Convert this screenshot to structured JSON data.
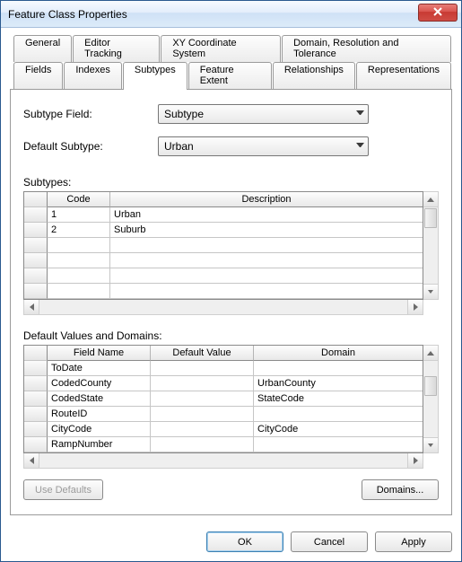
{
  "window": {
    "title": "Feature Class Properties"
  },
  "tabs_row1": [
    {
      "label": "General"
    },
    {
      "label": "Editor Tracking"
    },
    {
      "label": "XY Coordinate System"
    },
    {
      "label": "Domain, Resolution and Tolerance"
    }
  ],
  "tabs_row2": [
    {
      "label": "Fields"
    },
    {
      "label": "Indexes"
    },
    {
      "label": "Subtypes",
      "active": true
    },
    {
      "label": "Feature Extent"
    },
    {
      "label": "Relationships"
    },
    {
      "label": "Representations"
    }
  ],
  "form": {
    "subtype_field_label": "Subtype Field:",
    "subtype_field_value": "Subtype",
    "default_subtype_label": "Default Subtype:",
    "default_subtype_value": "Urban"
  },
  "subtypes_section": {
    "label": "Subtypes:",
    "columns": {
      "code": "Code",
      "description": "Description"
    },
    "rows": [
      {
        "code": "1",
        "description": "Urban"
      },
      {
        "code": "2",
        "description": "Suburb"
      },
      {
        "code": "",
        "description": ""
      },
      {
        "code": "",
        "description": ""
      },
      {
        "code": "",
        "description": ""
      },
      {
        "code": "",
        "description": ""
      }
    ]
  },
  "dvd_section": {
    "label": "Default Values and Domains:",
    "columns": {
      "field": "Field Name",
      "default": "Default Value",
      "domain": "Domain"
    },
    "rows": [
      {
        "field": "ToDate",
        "default": "",
        "domain": ""
      },
      {
        "field": "CodedCounty",
        "default": "",
        "domain": "UrbanCounty"
      },
      {
        "field": "CodedState",
        "default": "",
        "domain": "StateCode"
      },
      {
        "field": "RouteID",
        "default": "",
        "domain": ""
      },
      {
        "field": "CityCode",
        "default": "",
        "domain": "CityCode"
      },
      {
        "field": "RampNumber",
        "default": "",
        "domain": ""
      }
    ]
  },
  "buttons": {
    "use_defaults": "Use Defaults",
    "domains": "Domains...",
    "ok": "OK",
    "cancel": "Cancel",
    "apply": "Apply"
  }
}
